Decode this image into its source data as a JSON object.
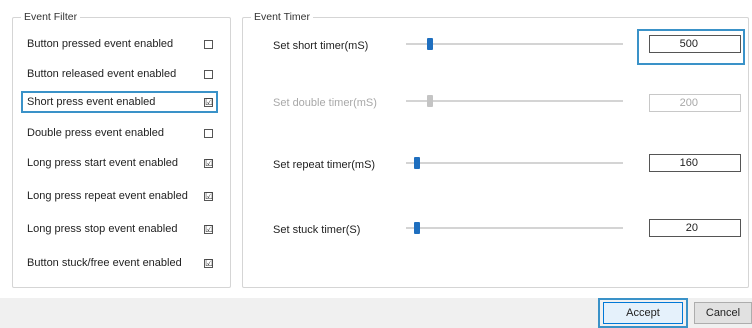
{
  "event_filter": {
    "title": "Event Filter",
    "items": [
      {
        "label": "Button pressed event enabled",
        "checked": false
      },
      {
        "label": "Button released event enabled",
        "checked": false
      },
      {
        "label": "Short press event enabled",
        "checked": true
      },
      {
        "label": "Double press event enabled",
        "checked": false
      },
      {
        "label": "Long press start event enabled",
        "checked": true
      },
      {
        "label": "Long press repeat event enabled",
        "checked": true
      },
      {
        "label": "Long press stop event enabled",
        "checked": true
      },
      {
        "label": "Button stuck/free event enabled",
        "checked": true
      }
    ],
    "check_mark": "☑",
    "focused_item": "Short press event enabled"
  },
  "event_timer": {
    "title": "Event Timer",
    "rows": [
      {
        "label": "Set short timer(mS)",
        "value": "500",
        "enabled": true,
        "slider_fraction": 0.1
      },
      {
        "label": "Set double timer(mS)",
        "value": "200",
        "enabled": false,
        "slider_fraction": 0.1
      },
      {
        "label": "Set repeat timer(mS)",
        "value": "160",
        "enabled": true,
        "slider_fraction": 0.04
      },
      {
        "label": "Set stuck timer(S)",
        "value": "20",
        "enabled": true,
        "slider_fraction": 0.04
      }
    ]
  },
  "footer": {
    "accept_label": "Accept",
    "cancel_label": "Cancel"
  },
  "colors": {
    "focus": "#3a92c8",
    "slider_thumb": "#1f6fbf",
    "disabled_text": "#a8a8a8"
  }
}
